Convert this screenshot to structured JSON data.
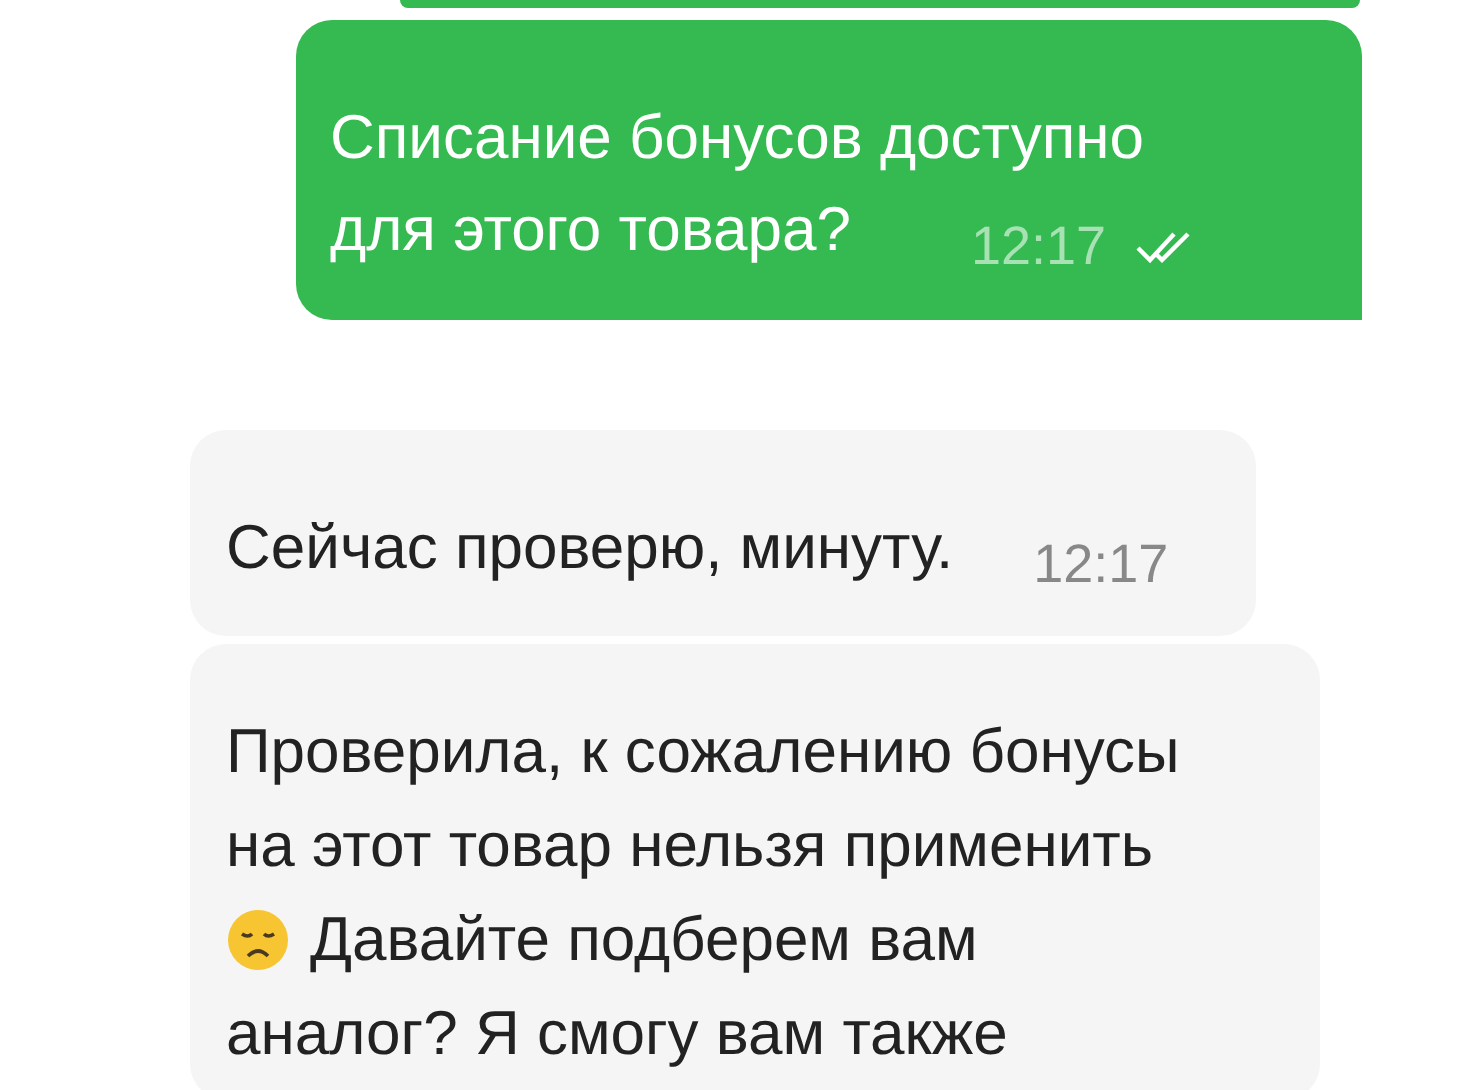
{
  "messages": [
    {
      "kind": "cut"
    },
    {
      "kind": "outgoing",
      "lines": [
        "Списание бонусов доступно",
        "для этого товара?"
      ],
      "time": "12:17",
      "read": true
    },
    {
      "kind": "incoming",
      "text": "Сейчас проверю, минуту.",
      "time": "12:17"
    },
    {
      "kind": "incoming",
      "lines": [
        {
          "text": "Проверила, к сожалению бонусы",
          "emoji": false
        },
        {
          "text": "на этот товар нельзя применить",
          "emoji": false
        },
        {
          "text": "Давайте подберем вам",
          "emoji": true
        },
        {
          "text": "аналог? Я смогу вам также",
          "emoji": false
        }
      ]
    }
  ]
}
